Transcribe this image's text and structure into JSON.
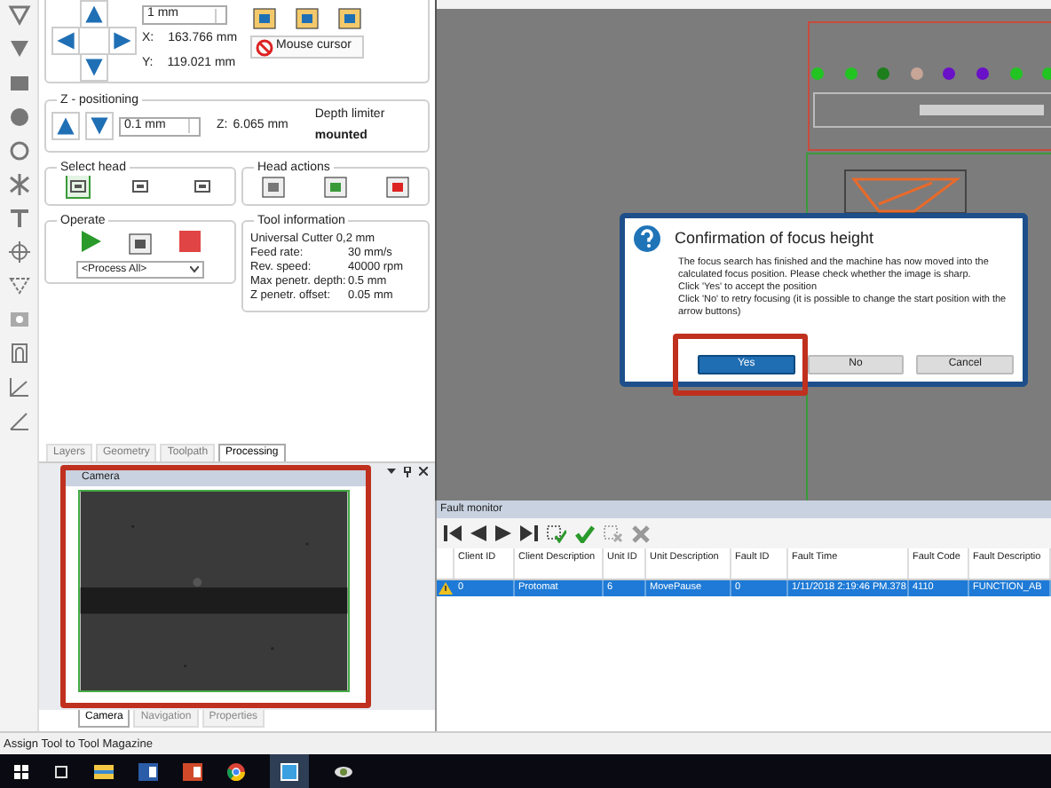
{
  "position": {
    "step": "1 mm",
    "x_label": "X:",
    "x_value": "163.766 mm",
    "y_label": "Y:",
    "y_value": "119.021 mm",
    "mouse_cursor_button": "Mouse cursor"
  },
  "z_positioning": {
    "title": "Z - positioning",
    "step": "0.1 mm",
    "z_label": "Z:",
    "z_value": "6.065 mm",
    "depth_limiter_label": "Depth limiter",
    "depth_limiter_value": "mounted"
  },
  "select_head": {
    "title": "Select head",
    "heads": [
      {
        "selected": true
      },
      {
        "selected": false
      },
      {
        "selected": false
      }
    ]
  },
  "head_actions": {
    "title": "Head actions"
  },
  "operate": {
    "title": "Operate",
    "process": "<Process All>"
  },
  "tool_information": {
    "title": "Tool information",
    "tool": "Universal Cutter 0,2 mm",
    "rows": [
      {
        "label": "Feed rate:",
        "value": "30 mm/s"
      },
      {
        "label": "Rev. speed:",
        "value": "40000 rpm"
      },
      {
        "label": "Max penetr. depth:",
        "value": "0.5 mm"
      },
      {
        "label": "Z penetr. offset:",
        "value": "0.05 mm"
      }
    ]
  },
  "panel_tabs": [
    {
      "label": "Layers",
      "selected": false
    },
    {
      "label": "Geometry",
      "selected": false
    },
    {
      "label": "Toolpath",
      "selected": false
    },
    {
      "label": "Processing",
      "selected": true
    }
  ],
  "camera": {
    "title": "Camera"
  },
  "dock_tabs": [
    {
      "label": "Camera",
      "selected": true
    },
    {
      "label": "Navigation",
      "selected": false
    },
    {
      "label": "Properties",
      "selected": false
    }
  ],
  "canvas": {
    "dots": [
      {
        "color": "#22c422"
      },
      {
        "color": "#22c422"
      },
      {
        "color": "#1c7f1c"
      },
      {
        "color": "#c7a597"
      },
      {
        "color": "#6a10c8"
      },
      {
        "color": "#6a10c8"
      },
      {
        "color": "#22c422"
      },
      {
        "color": "#22c422"
      }
    ]
  },
  "dialog": {
    "title": "Confirmation of focus height",
    "message": [
      "The focus search has finished and the machine has now moved into the calculated focus position. Please check whether the image is sharp.",
      "Click 'Yes' to accept the position",
      "Click 'No' to retry focusing (it is possible to change the start position with the arrow buttons)"
    ],
    "buttons": [
      {
        "label": "Yes",
        "selected": true
      },
      {
        "label": "No",
        "selected": false
      },
      {
        "label": "Cancel",
        "selected": false
      }
    ]
  },
  "fault_monitor": {
    "title": "Fault monitor",
    "columns": [
      "Client ID",
      "Client Description",
      "Unit ID",
      "Unit Description",
      "Fault ID",
      "Fault Time",
      "Fault Code",
      "Fault Descriptio"
    ],
    "rows": [
      {
        "selected": true,
        "cells": [
          "0",
          "Protomat",
          "6",
          "MovePause",
          "0",
          "1/11/2018 2:19:46 PM.378",
          "4110",
          "FUNCTION_AB"
        ]
      }
    ]
  },
  "status_bar": "Assign Tool to Tool Magazine"
}
